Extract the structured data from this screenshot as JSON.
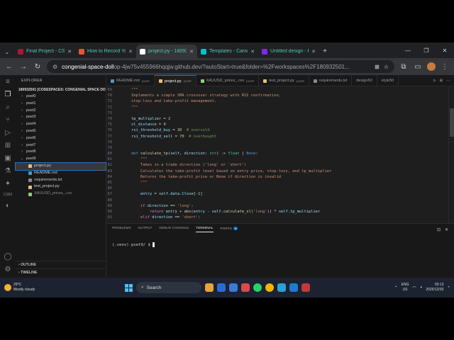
{
  "browser": {
    "tabs": [
      {
        "label": "Final Project - CS50",
        "color": "#a51c30",
        "active": false
      },
      {
        "label": "How to Record Your",
        "color": "#e6552e",
        "active": false
      },
      {
        "label": "project.py - 18093",
        "color": "#ffffff",
        "active": true
      },
      {
        "label": "Templates - Canva",
        "color": "#00c4cc",
        "active": false
      },
      {
        "label": "Untitled design - Pre",
        "color": "#7d2ae8",
        "active": false
      }
    ],
    "new_tab": "+",
    "url_host": "congenial-space-doll",
    "url_rest": "op-4jw75v455966hqqjw.github.dev/?autoStart=true&folder=%2Fworkspaces%2F180932501..."
  },
  "explorer": {
    "header": "EXPLORER",
    "root": "180932501 [CODESPACES: CONGENIAL SPACE DO...",
    "items": [
      {
        "label": "pset0",
        "type": "folder",
        "expanded": false
      },
      {
        "label": "pset1",
        "type": "folder",
        "expanded": false
      },
      {
        "label": "pset2",
        "type": "folder",
        "expanded": false
      },
      {
        "label": "pset3",
        "type": "folder",
        "expanded": false
      },
      {
        "label": "pset4",
        "type": "folder",
        "expanded": false
      },
      {
        "label": "pset5",
        "type": "folder",
        "expanded": false
      },
      {
        "label": "pset6",
        "type": "folder",
        "expanded": false
      },
      {
        "label": "pset7",
        "type": "folder",
        "expanded": false
      },
      {
        "label": "pset8",
        "type": "folder",
        "expanded": false
      },
      {
        "label": "pset9",
        "type": "folder",
        "expanded": true
      },
      {
        "label": "project.py",
        "type": "file",
        "selected": true,
        "color": "#e5c07b"
      },
      {
        "label": "README.md",
        "type": "file",
        "color": "#519aba"
      },
      {
        "label": "requirements.txt",
        "type": "file",
        "color": "#8a8a8a"
      },
      {
        "label": "test_project.py",
        "type": "file",
        "color": "#e5c07b"
      },
      {
        "label": "XAUUSD_prices_.csv",
        "type": "file",
        "color": "#89d185",
        "dim": true
      }
    ],
    "outline": "OUTLINE",
    "timeline": "TIMELINE"
  },
  "editor_tabs": [
    {
      "label": "README.md",
      "sub": "pset9",
      "icon": "md",
      "active": false
    },
    {
      "label": "project.py",
      "sub": "pset9",
      "icon": "py",
      "active": true
    },
    {
      "label": "XAUUSD_prices_.csv",
      "sub": "pset9",
      "icon": "csv",
      "active": false
    },
    {
      "label": "test_project.py",
      "sub": "pset9",
      "icon": "py",
      "active": false
    },
    {
      "label": "requirements.txt",
      "sub": "",
      "icon": "txt",
      "active": false
    },
    {
      "label": "design50",
      "sub": "",
      "icon": "",
      "active": false
    },
    {
      "label": "style50",
      "sub": "",
      "icon": "",
      "active": false
    }
  ],
  "code_lines": [
    {
      "n": "69",
      "html": "    <span class=\"s\">\"\"\"</span>"
    },
    {
      "n": "70",
      "html": "    <span class=\"s\">Implements a simple SMA crossover strategy with RSI confirmation,</span>"
    },
    {
      "n": "71",
      "html": "    <span class=\"s\">stop-loss and take-profit management.</span>"
    },
    {
      "n": "72",
      "html": "    <span class=\"s\">\"\"\"</span>"
    },
    {
      "n": "73",
      "html": ""
    },
    {
      "n": "74",
      "html": "    <span class=\"v\">tp_multiplier</span> = <span class=\"n\">2</span>"
    },
    {
      "n": "75",
      "html": "    <span class=\"v\">sl_distance</span> = <span class=\"n\">0</span>"
    },
    {
      "n": "76",
      "html": "    <span class=\"v\">rsi_threshold_buy</span> = <span class=\"n\">30</span>  <span class=\"c\"># oversold</span>"
    },
    {
      "n": "77",
      "html": "    <span class=\"v\">rsi_threshold_sell</span> = <span class=\"n\">70</span>  <span class=\"c\"># overbought</span>"
    },
    {
      "n": "78",
      "html": ""
    },
    {
      "n": "79",
      "html": ""
    },
    {
      "n": "80",
      "html": "    <span class=\"k\">def</span> <span class=\"f\">calculate_tp</span>(<span class=\"v\">self</span>, <span class=\"v\">direction</span>: <span class=\"t\">str</span>) -&gt; <span class=\"t\">float</span> | <span class=\"k\">None</span>:"
    },
    {
      "n": "81",
      "html": "        <span class=\"s\">\"\"\"</span>"
    },
    {
      "n": "82",
      "html": "        <span class=\"s\">Takes in a trade direction ('long' or 'short')</span>"
    },
    {
      "n": "83",
      "html": "        <span class=\"s\">Calculates the take-profit level based on entry price, stop-loss, and tp_multiplier</span>"
    },
    {
      "n": "84",
      "html": "        <span class=\"s\">Returns the take-profit price or None if direction is invalid</span>"
    },
    {
      "n": "85",
      "html": "        <span class=\"s\">\"\"\"</span>"
    },
    {
      "n": "86",
      "html": ""
    },
    {
      "n": "87",
      "html": "        <span class=\"v\">entry</span> = <span class=\"v\">self</span>.<span class=\"v\">data</span>.<span class=\"v\">Close</span>[<span class=\"n\">-1</span>]"
    },
    {
      "n": "88",
      "html": ""
    },
    {
      "n": "89",
      "html": "        <span class=\"kc\">if</span> <span class=\"v\">direction</span> == <span class=\"s\">'long'</span>:"
    },
    {
      "n": "90",
      "html": "            <span class=\"kc\">return</span> <span class=\"v\">entry</span> + <span class=\"f\">abs</span>(<span class=\"v\">entry</span> - <span class=\"v\">self</span>.<span class=\"f\">calculate_sl</span>(<span class=\"s\">'long'</span>)) * <span class=\"v\">self</span>.<span class=\"v\">tp_multiplier</span>"
    },
    {
      "n": "91",
      "html": "        <span class=\"kc\">elif</span> <span class=\"v\">direction</span> == <span class=\"s\">'short'</span>:"
    }
  ],
  "panel": {
    "tabs": [
      "PROBLEMS",
      "OUTPUT",
      "DEBUG CONSOLE",
      "TERMINAL",
      "PORTS"
    ],
    "active_tab": "TERMINAL",
    "ports_count": "4",
    "prompt": "(.venv) pset9/ $ "
  },
  "taskbar": {
    "temp": "29°C",
    "weather": "Mostly cloudy",
    "search": "Search",
    "lang_top": "ENG",
    "lang_bottom": "US",
    "time": "03:13",
    "date": "2025/12/30"
  }
}
